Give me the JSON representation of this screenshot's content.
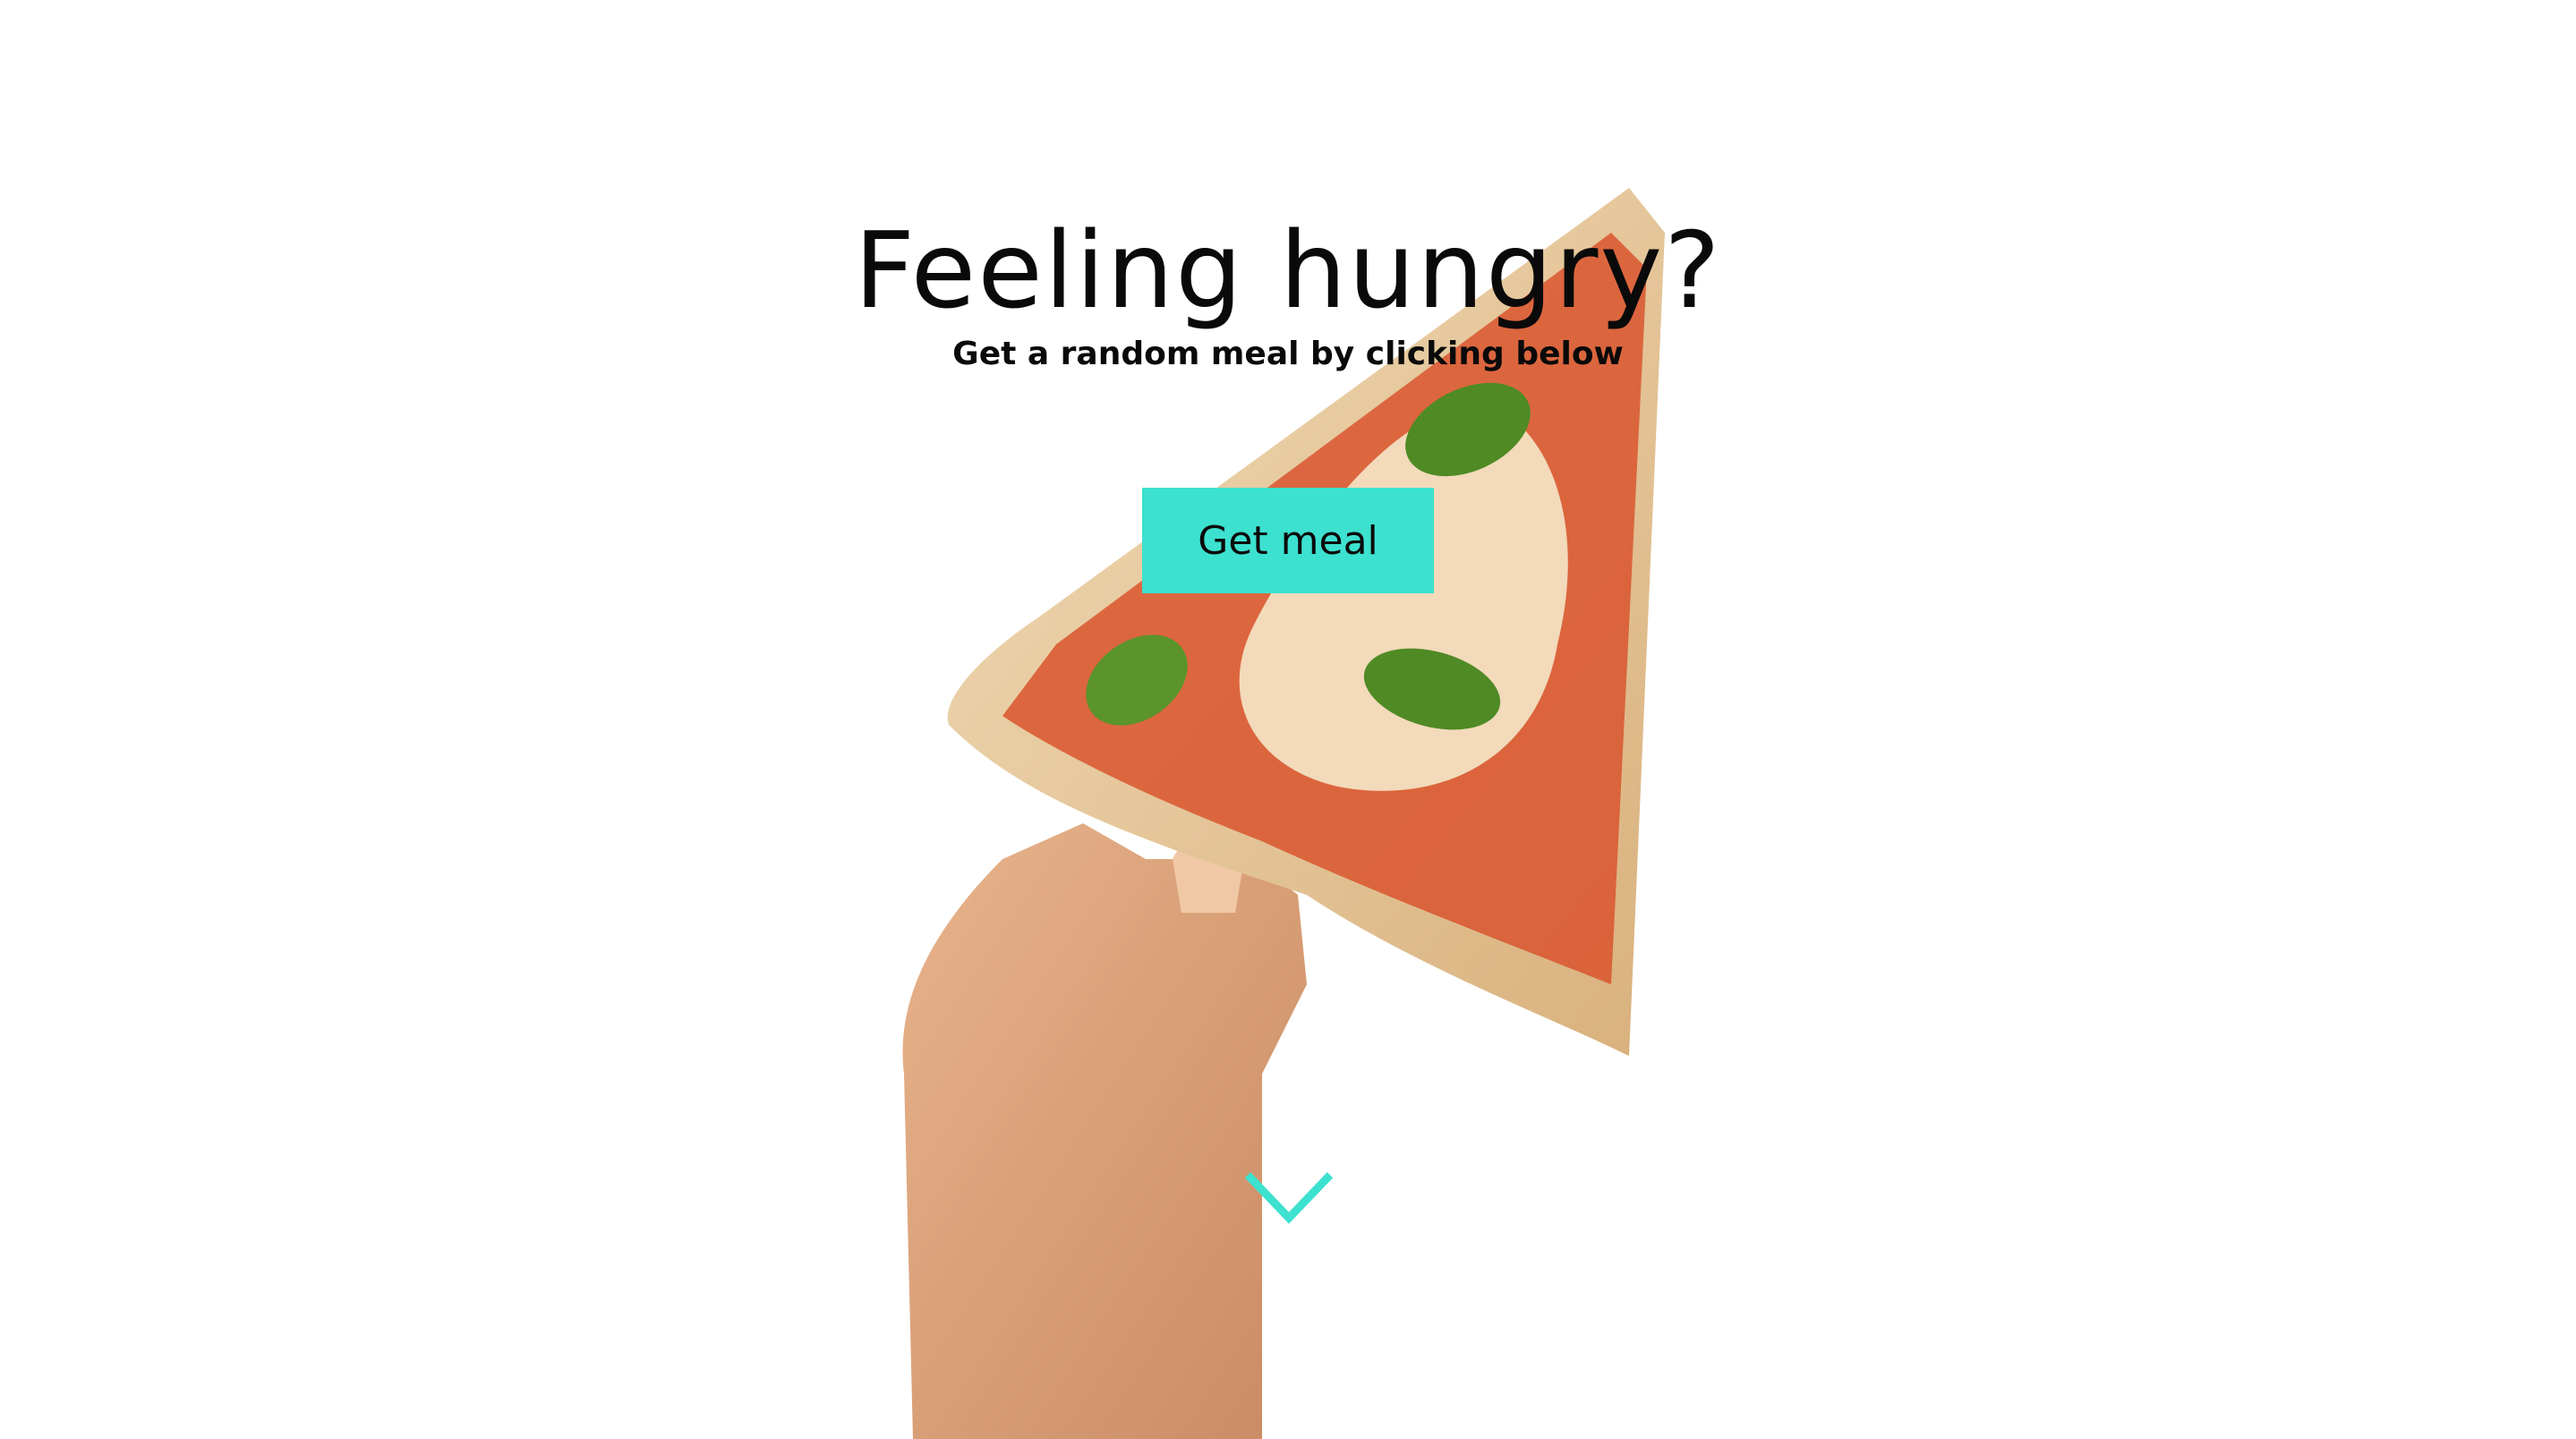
{
  "hero": {
    "title": "Feeling hungry?",
    "subtitle": "Get a random meal by clicking below",
    "button_label": "Get meal",
    "image_icon": "pizza-slice-in-hand-photo",
    "scroll_icon": "chevron-down-icon"
  },
  "colors": {
    "accent": "#3de1cf",
    "text": "#0a0a0a",
    "background": "#ffffff"
  }
}
